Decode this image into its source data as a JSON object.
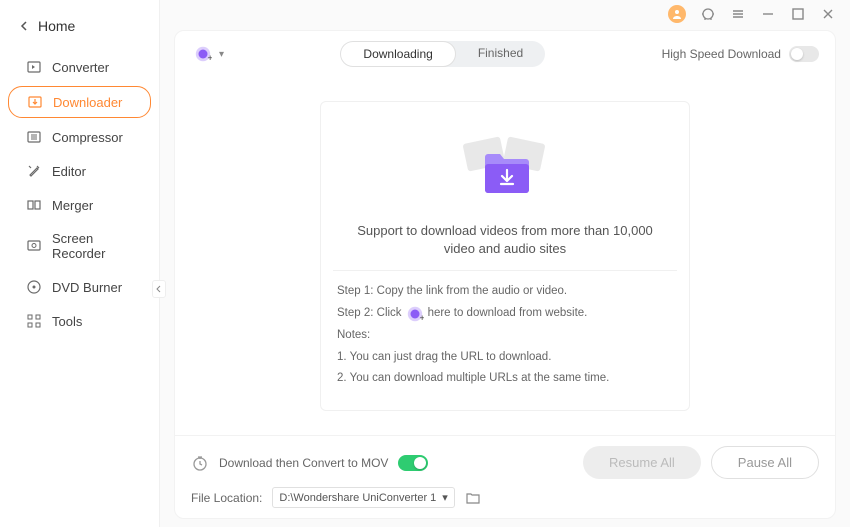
{
  "sidebar": {
    "home": "Home",
    "items": [
      {
        "label": "Converter"
      },
      {
        "label": "Downloader"
      },
      {
        "label": "Compressor"
      },
      {
        "label": "Editor"
      },
      {
        "label": "Merger"
      },
      {
        "label": "Screen Recorder"
      },
      {
        "label": "DVD Burner"
      },
      {
        "label": "Tools"
      }
    ]
  },
  "tabs": {
    "downloading": "Downloading",
    "finished": "Finished"
  },
  "high_speed_label": "High Speed Download",
  "empty": {
    "title": "Support to download videos from more than 10,000 video and audio sites",
    "step1": "Step 1: Copy the link from the audio or video.",
    "step2a": "Step 2: Click",
    "step2b": "here to download from website.",
    "notes_label": "Notes:",
    "note1": "1. You can just drag the URL to download.",
    "note2": "2. You can download multiple URLs at the same time."
  },
  "footer": {
    "convert_label": "Download then Convert to MOV",
    "location_label": "File Location:",
    "location_value": "D:\\Wondershare UniConverter 1",
    "resume": "Resume All",
    "pause": "Pause All"
  }
}
